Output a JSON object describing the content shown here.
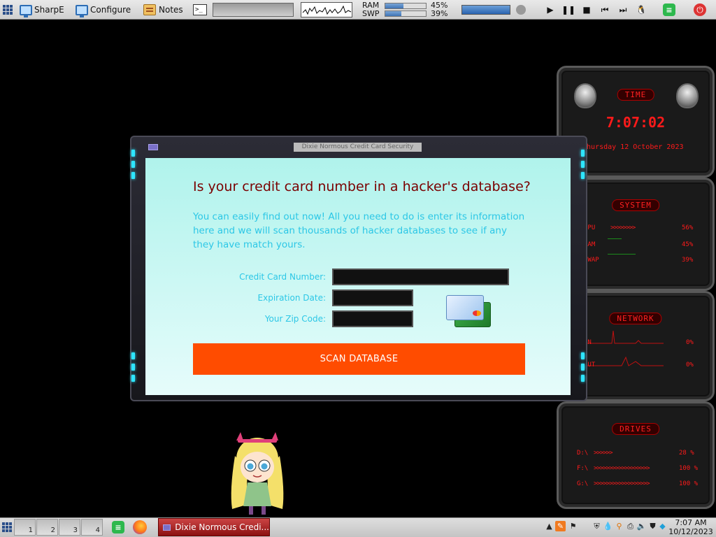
{
  "top_panel": {
    "launchers": [
      {
        "label": "SharpE",
        "icon": "monitor-icon"
      },
      {
        "label": "Configure",
        "icon": "monitor-icon"
      },
      {
        "label": "Notes",
        "icon": "notes-icon"
      }
    ],
    "terminal_glyph": ">_",
    "ram_label": "RAM",
    "swp_label": "SWP",
    "ram_pct": "45%",
    "swp_pct": "39%",
    "ram_fill": 0.45,
    "swp_fill": 0.39
  },
  "window": {
    "title": "Dixie Normous Credit Card Security",
    "headline": "Is your credit card number in a hacker's database?",
    "intro": "You can easily find out now! All you need to do is enter its information here and we will scan thousands of hacker databases to see if any they have match yours.",
    "form": {
      "card_label": "Credit Card Number:",
      "card_value": "",
      "exp_label": "Expiration Date:",
      "exp_value": "",
      "zip_label": "Your Zip Code:",
      "zip_value": ""
    },
    "scan_button": "SCAN DATABASE"
  },
  "widgets": {
    "time": {
      "title": "TIME",
      "clock": "7:07:02",
      "date": "Thursday 12 October 2023"
    },
    "system": {
      "title": "SYSTEM",
      "rows": [
        {
          "label": "CPU",
          "value": "56%"
        },
        {
          "label": "RAM",
          "value": "45%"
        },
        {
          "label": "SWAP",
          "value": "39%"
        }
      ]
    },
    "network": {
      "title": "NETWORK",
      "rows": [
        {
          "label": "IN",
          "value": "0%"
        },
        {
          "label": "OUT",
          "value": "0%"
        }
      ]
    },
    "drives": {
      "title": "DRIVES",
      "rows": [
        {
          "label": "D:\\",
          "value": "28 %"
        },
        {
          "label": "F:\\",
          "value": "100 %"
        },
        {
          "label": "G:\\",
          "value": "100 %"
        }
      ]
    }
  },
  "taskbar": {
    "workspaces": [
      "1",
      "2",
      "3",
      "4"
    ],
    "task_label": "Dixie Normous Credi...",
    "clock_time": "7:07 AM",
    "clock_date": "10/12/2023"
  },
  "colors": {
    "accent_orange": "#ff4c00",
    "headline_red": "#7a0000",
    "text_cyan": "#2cc7e6",
    "widget_red": "#ff1a1a"
  }
}
